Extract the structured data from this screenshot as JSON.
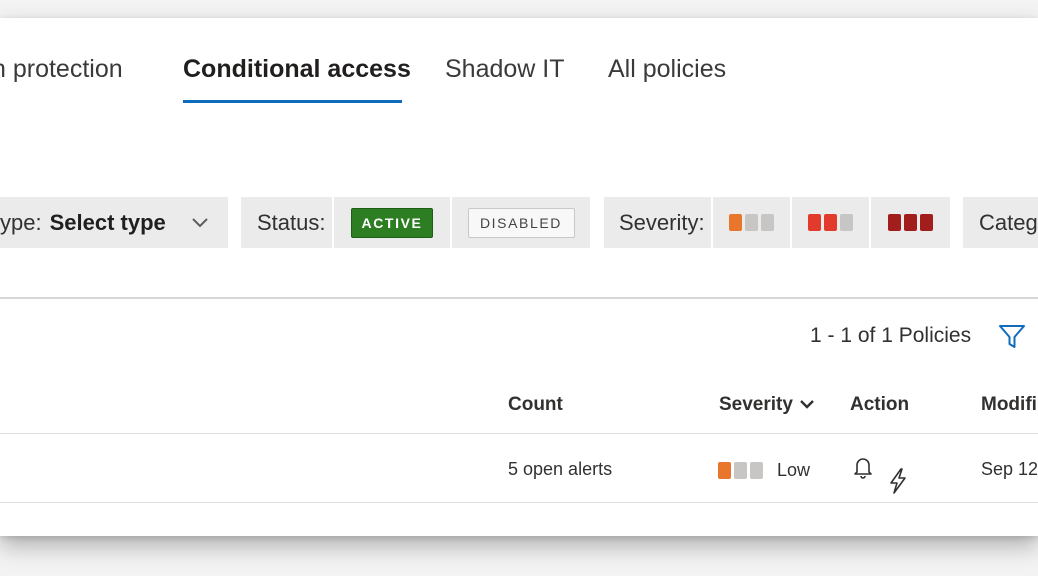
{
  "tabs": [
    {
      "label": "n protection",
      "active": false
    },
    {
      "label": "Conditional access",
      "active": true
    },
    {
      "label": "Shadow IT",
      "active": false
    },
    {
      "label": "All policies",
      "active": false
    }
  ],
  "filters": {
    "type_label": "ype:",
    "type_value": "Select type",
    "status_label": "Status:",
    "status_active": "ACTIVE",
    "status_disabled": "DISABLED",
    "severity_label": "Severity:",
    "category_label": "Categ"
  },
  "colors": {
    "accent": "#0f6cbd",
    "active_badge": "#2d7d22",
    "sev_low": "#e8762c",
    "sev_medium": "#e23a2c",
    "sev_high": "#a21e1c",
    "sev_empty": "#c8c6c4"
  },
  "table": {
    "count_text": "1 - 1 of 1 Policies",
    "headers": {
      "count": "Count",
      "severity": "Severity",
      "action": "Action",
      "modified": "Modifi"
    },
    "rows": [
      {
        "count": "5 open alerts",
        "severity": "Low",
        "action_icons": [
          "bell-icon",
          "lightning-icon"
        ],
        "modified": "Sep 12"
      }
    ]
  }
}
